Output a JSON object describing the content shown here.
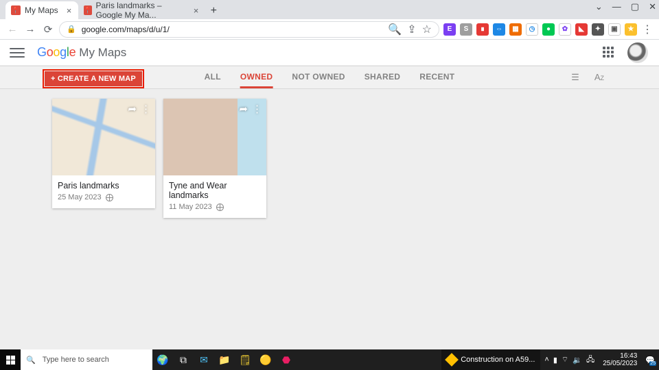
{
  "browser": {
    "tabs": [
      {
        "title": "My Maps"
      },
      {
        "title": "Paris landmarks – Google My Ma..."
      }
    ],
    "url": "google.com/maps/d/u/1/"
  },
  "app": {
    "name": "My Maps",
    "create_label": "+ CREATE A NEW MAP",
    "filters": {
      "all": "ALL",
      "owned": "OWNED",
      "not_owned": "NOT OWNED",
      "shared": "SHARED",
      "recent": "RECENT"
    }
  },
  "maps": [
    {
      "title": "Paris landmarks",
      "date": "25 May 2023"
    },
    {
      "title": "Tyne and Wear landmarks",
      "date": "11 May 2023"
    }
  ],
  "taskbar": {
    "search_placeholder": "Type here to search",
    "toast": "Construction on A59...",
    "time": "16:43",
    "date": "25/05/2023",
    "action_center_badge": "25"
  }
}
